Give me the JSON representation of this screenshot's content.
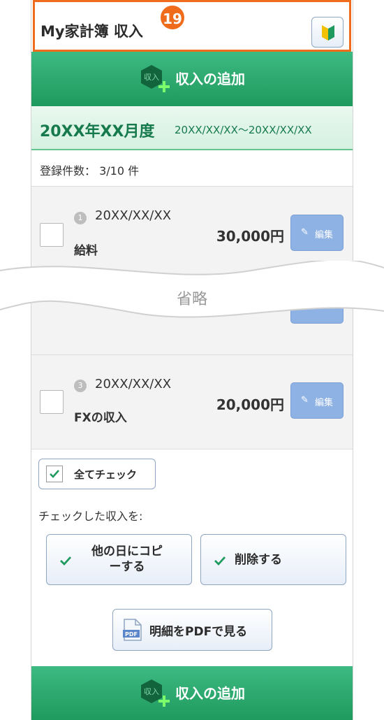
{
  "header": {
    "title": "My家計簿 収入",
    "badge": "19",
    "help_icon": "beginner-mark-icon"
  },
  "add_income": {
    "icon_text": "収入",
    "label": "収入の追加"
  },
  "period": {
    "main": "20XX年XX月度",
    "range": "20XX/XX/XX〜20XX/XX/XX"
  },
  "count_text": "登録件数： 3/10 件",
  "rows": [
    {
      "num": "1",
      "date": "20XX/XX/XX",
      "name": "給料",
      "amount": "30,000円",
      "edit": "編集"
    },
    {
      "num": "3",
      "date": "20XX/XX/XX",
      "name": "FXの収入",
      "amount": "20,000円",
      "edit": "編集"
    }
  ],
  "omitted": "省略",
  "check_all": "全てチェック",
  "checked_label": "チェックした収入を:",
  "actions": {
    "copy": "他の日にコピ\nーする",
    "delete": "削除する"
  },
  "pdf": {
    "icon_text": "PDF",
    "label": "明細をPDFで見る"
  },
  "colors": {
    "accent_orange": "#ef6c1c",
    "green": "#1f9a5e",
    "edit_blue": "#8fb2e4"
  }
}
